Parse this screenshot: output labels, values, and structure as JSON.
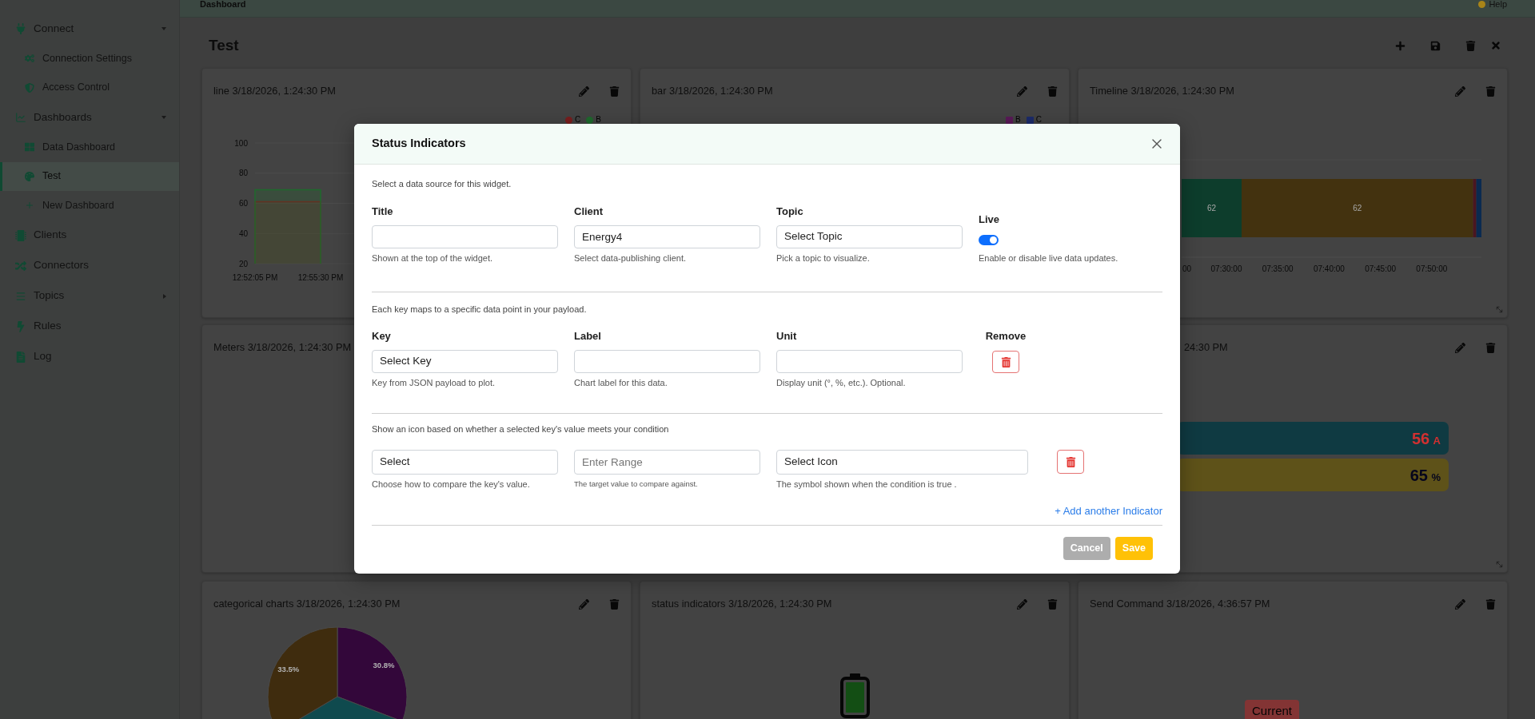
{
  "topbar": {
    "title": "Dashboard",
    "help": "Help"
  },
  "sidebar": {
    "items": [
      {
        "label": "Connect",
        "selected": false,
        "expanded": true,
        "children": [
          {
            "label": "Connection Settings",
            "selected": false
          },
          {
            "label": "Access Control",
            "selected": false
          }
        ]
      },
      {
        "label": "Dashboards",
        "selected": false,
        "expanded": true,
        "children": [
          {
            "label": "Data Dashboard",
            "selected": false
          },
          {
            "label": "Test",
            "selected": true
          },
          {
            "label": "New Dashboard",
            "selected": false
          }
        ]
      },
      {
        "label": "Clients",
        "selected": false
      },
      {
        "label": "Connectors",
        "selected": false
      },
      {
        "label": "Topics",
        "selected": false,
        "expanded": false
      },
      {
        "label": "Rules",
        "selected": false
      },
      {
        "label": "Log",
        "selected": false
      }
    ]
  },
  "dashboard": {
    "title": "Test"
  },
  "widget_rows": [
    [
      {
        "kind": "line",
        "title": "line 3/18/2026, 1:24:30 PM",
        "toolbar": true,
        "chart_data": {
          "type": "area",
          "legend": "top-right",
          "x": [
            "12:52:05 PM",
            "12:55:30 PM"
          ],
          "series": [
            {
              "name": "C",
              "color": "#7a1e1e",
              "values": [
                61,
                61
              ]
            },
            {
              "name": "B",
              "color": "#1f6a2d",
              "values": [
                69,
                69
              ]
            }
          ],
          "ylim": [
            20,
            100
          ],
          "yticks": [
            20,
            40,
            60,
            80,
            100
          ]
        }
      },
      {
        "kind": "bar",
        "title": "bar 3/18/2026, 1:24:30 PM",
        "toolbar": true,
        "legend": [
          {
            "label": "B",
            "color": "#5a1a58"
          },
          {
            "label": "C",
            "color": "#1c2b6a"
          }
        ]
      },
      {
        "kind": "timeline",
        "title": "Timeline 3/18/2026, 1:24:30 PM",
        "toolbar": true,
        "covered_left": true,
        "resize_handle": true,
        "segments": [
          {
            "label": "62",
            "color": "#0d3d2c"
          },
          {
            "label": "62",
            "color": "#43320f"
          },
          {
            "color": "#4a1620"
          },
          {
            "color": "#0a2a50"
          }
        ],
        "ticks": [
          "00",
          "07:30:00",
          "07:35:00",
          "07:40:00",
          "07:45:00",
          "07:50:00"
        ]
      }
    ],
    [
      {
        "kind": "meters",
        "title": "Meters 3/18/2026, 1:24:30 PM"
      },
      {
        "kind": "meters",
        "title": "24:30 PM",
        "title_covered": true,
        "covered_left": true,
        "toolbar": true,
        "resize_handle": true,
        "bars": [
          {
            "value": "56",
            "unit": "A",
            "color": "#0f3a42"
          },
          {
            "value": "65",
            "unit": "%",
            "color": "#5e5219"
          }
        ]
      }
    ],
    [
      {
        "kind": "pie",
        "title": "categorical charts 3/18/2026, 1:24:30 PM",
        "toolbar": true,
        "chart_data": {
          "type": "pie",
          "values": [
            30.8,
            35.7,
            33.5
          ],
          "value_labels": [
            "30.8%",
            null,
            "33.5%"
          ]
        }
      },
      {
        "kind": "status",
        "title": "status indicators 3/18/2026, 1:24:30 PM",
        "toolbar": true
      },
      {
        "kind": "command",
        "title": "Send Command 3/18/2026, 4:36:57 PM",
        "toolbar": true,
        "buttons": [
          "Current"
        ]
      }
    ]
  ],
  "modal": {
    "title": "Status Indicators",
    "sections": [
      {
        "kind": "source",
        "hint": "Select a data source for this widget.",
        "fields": [
          {
            "kind": "text",
            "label": "Title",
            "help": "Shown at the top of the widget."
          },
          {
            "kind": "text",
            "label": "Client",
            "value": "Energy4",
            "help": "Select data-publishing client."
          },
          {
            "kind": "select",
            "label": "Topic",
            "value": "Select Topic",
            "help": "Pick a topic to visualize."
          },
          {
            "kind": "switch",
            "label": "Live",
            "on": true,
            "help": "Enable or disable live data updates."
          }
        ]
      },
      {
        "kind": "keys",
        "hint": "Each key maps to a specific data point in your payload.",
        "fields": [
          {
            "kind": "select",
            "label": "Key",
            "value": "Select Key",
            "help": "Key from JSON payload to plot."
          },
          {
            "kind": "text",
            "label": "Label",
            "help": "Chart label for this data."
          },
          {
            "kind": "text",
            "label": "Unit",
            "help": "Display unit (°, %, etc.). Optional."
          },
          {
            "kind": "remove",
            "label": "Remove"
          }
        ]
      },
      {
        "kind": "conditions",
        "hint": "Show an icon based on whether a selected key's value meets your condition",
        "fields": [
          {
            "kind": "select",
            "value": "Select",
            "help": "Choose how to compare the key's value."
          },
          {
            "kind": "text",
            "placeholder": "Enter Range",
            "help": "The target value to compare against."
          },
          {
            "kind": "select",
            "value": "Select Icon",
            "help": "The symbol shown when the condition is true ."
          },
          {
            "kind": "remove"
          }
        ],
        "add_link": "+ Add another Indicator"
      }
    ],
    "buttons": [
      {
        "kind": "cancel",
        "label": "Cancel"
      },
      {
        "kind": "save",
        "label": "Save"
      }
    ]
  }
}
